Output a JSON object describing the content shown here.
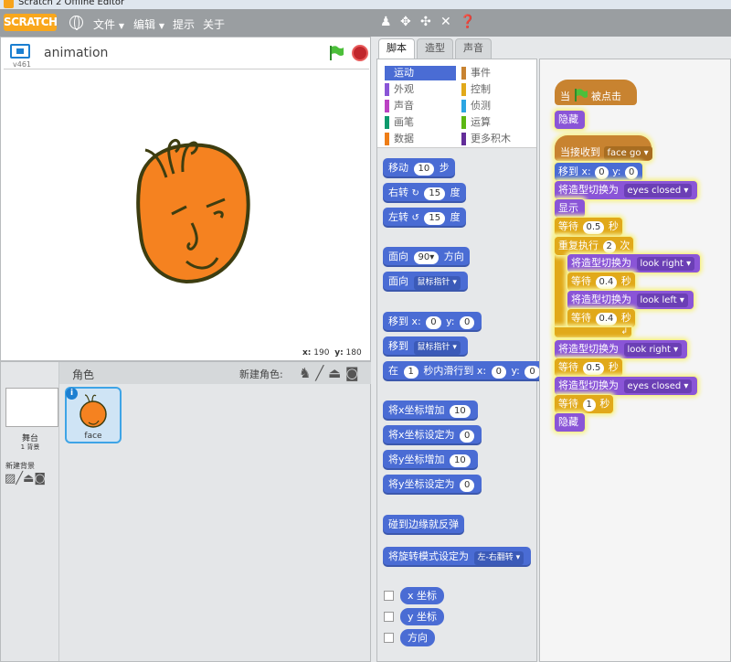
{
  "window": {
    "title": "Scratch 2 Offline Editor"
  },
  "menu": {
    "logo": "SCRATCH",
    "file": "文件",
    "edit": "编辑",
    "tips": "提示",
    "about": "关于"
  },
  "stage": {
    "version": "v461",
    "project_title": "animation",
    "coords": {
      "x_label": "x:",
      "x_value": "190",
      "y_label": "y:",
      "y_value": "180"
    }
  },
  "sprites": {
    "header": "角色",
    "new_sprite": "新建角色:",
    "stage_label": "舞台",
    "stage_backdrops": "1 背景",
    "new_backdrop": "新建背景",
    "sprite_name": "face"
  },
  "tabs": [
    "脚本",
    "造型",
    "声音"
  ],
  "categories": [
    {
      "label": "运动",
      "color": "#4a6cd4",
      "selected": true
    },
    {
      "label": "事件",
      "color": "#c88330"
    },
    {
      "label": "外观",
      "color": "#8a55d7"
    },
    {
      "label": "控制",
      "color": "#e1a91a"
    },
    {
      "label": "声音",
      "color": "#bb42c3"
    },
    {
      "label": "侦测",
      "color": "#2ca5e2"
    },
    {
      "label": "画笔",
      "color": "#0e9a6c"
    },
    {
      "label": "运算",
      "color": "#5cb712"
    },
    {
      "label": "数据",
      "color": "#ee7d16"
    },
    {
      "label": "更多积木",
      "color": "#632d99"
    }
  ],
  "palette": {
    "move": "移动",
    "move_val": "10",
    "steps": "步",
    "turn_right": "右转",
    "turn_right_val": "15",
    "deg1": "度",
    "turn_left": "左转",
    "turn_left_val": "15",
    "deg2": "度",
    "point_dir": "面向",
    "point_dir_val": "90",
    "dir_unit": "方向",
    "point_towards": "面向",
    "towards_target": "鼠标指针",
    "goto_xy": "移到",
    "x": "x:",
    "x_val": "0",
    "y": "y:",
    "y_val": "0",
    "goto": "移到",
    "goto_target": "鼠标指针",
    "glide": "在",
    "glide_secs": "1",
    "glide_mid": "秒内滑行到",
    "glide_x": "x:",
    "glide_x_val": "0",
    "glide_y": "y:",
    "glide_y_val": "0",
    "change_x": "将x坐标增加",
    "change_x_val": "10",
    "set_x": "将x坐标设定为",
    "set_x_val": "0",
    "change_y": "将y坐标增加",
    "change_y_val": "10",
    "set_y": "将y坐标设定为",
    "set_y_val": "0",
    "bounce": "碰到边缘就反弹",
    "rotation_style": "将旋转模式设定为",
    "rotation_style_val": "左-右翻转",
    "rep_x": "x 坐标",
    "rep_y": "y 坐标",
    "rep_dir": "方向"
  },
  "scripts": {
    "hat1_a": "当",
    "hat1_b": "被点击",
    "hide1": "隐藏",
    "hat2": "当接收到",
    "hat2_msg": "face go",
    "goto": "移到",
    "gx": "x:",
    "gx_val": "0",
    "gy": "y:",
    "gy_val": "0",
    "sw1": "将造型切换为",
    "sw1_val": "eyes closed",
    "show": "显示",
    "wait1": "等待",
    "wait1_val": "0.5",
    "wait1_unit": "秒",
    "repeat": "重复执行",
    "repeat_val": "2",
    "repeat_unit": "次",
    "sw2": "将造型切换为",
    "sw2_val": "look right",
    "wait2": "等待",
    "wait2_val": "0.4",
    "wait2_unit": "秒",
    "sw3": "将造型切换为",
    "sw3_val": "look left",
    "wait3": "等待",
    "wait3_val": "0.4",
    "wait3_unit": "秒",
    "sw4": "将造型切换为",
    "sw4_val": "look right",
    "wait4": "等待",
    "wait4_val": "0.5",
    "wait4_unit": "秒",
    "sw5": "将造型切换为",
    "sw5_val": "eyes closed",
    "wait5": "等待",
    "wait5_val": "1",
    "wait5_unit": "秒",
    "hide2": "隐藏"
  }
}
